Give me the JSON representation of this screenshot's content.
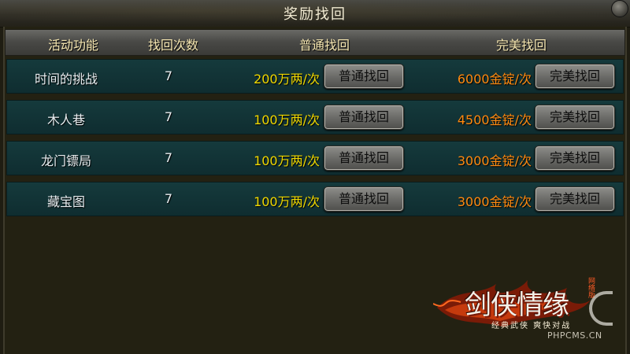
{
  "window": {
    "title": "奖励找回"
  },
  "table": {
    "headers": [
      "活动功能",
      "找回次数",
      "普通找回",
      "完美找回"
    ],
    "rows": [
      {
        "activity": "时间的挑战",
        "count": "7",
        "normal_cost": "200万两/次",
        "normal_button": "普通找回",
        "perfect_cost": "6000金锭/次",
        "perfect_button": "完美找回"
      },
      {
        "activity": "木人巷",
        "count": "7",
        "normal_cost": "100万两/次",
        "normal_button": "普通找回",
        "perfect_cost": "4500金锭/次",
        "perfect_button": "完美找回"
      },
      {
        "activity": "龙门镖局",
        "count": "7",
        "normal_cost": "100万两/次",
        "normal_button": "普通找回",
        "perfect_cost": "3000金锭/次",
        "perfect_button": "完美找回"
      },
      {
        "activity": "藏宝图",
        "count": "7",
        "normal_cost": "100万两/次",
        "normal_button": "普通找回",
        "perfect_cost": "3000金锭/次",
        "perfect_button": "完美找回"
      }
    ]
  },
  "logo": {
    "title": "剑侠情缘",
    "badge": "网络版",
    "subtitle": "经典武侠 爽快对战"
  },
  "watermark": "PHPCMS.CN",
  "colors": {
    "normal_cost": "#f0d800",
    "perfect_cost": "#ff8a10",
    "row_bg": "#153a3c",
    "header_text": "#f5e6b0"
  }
}
